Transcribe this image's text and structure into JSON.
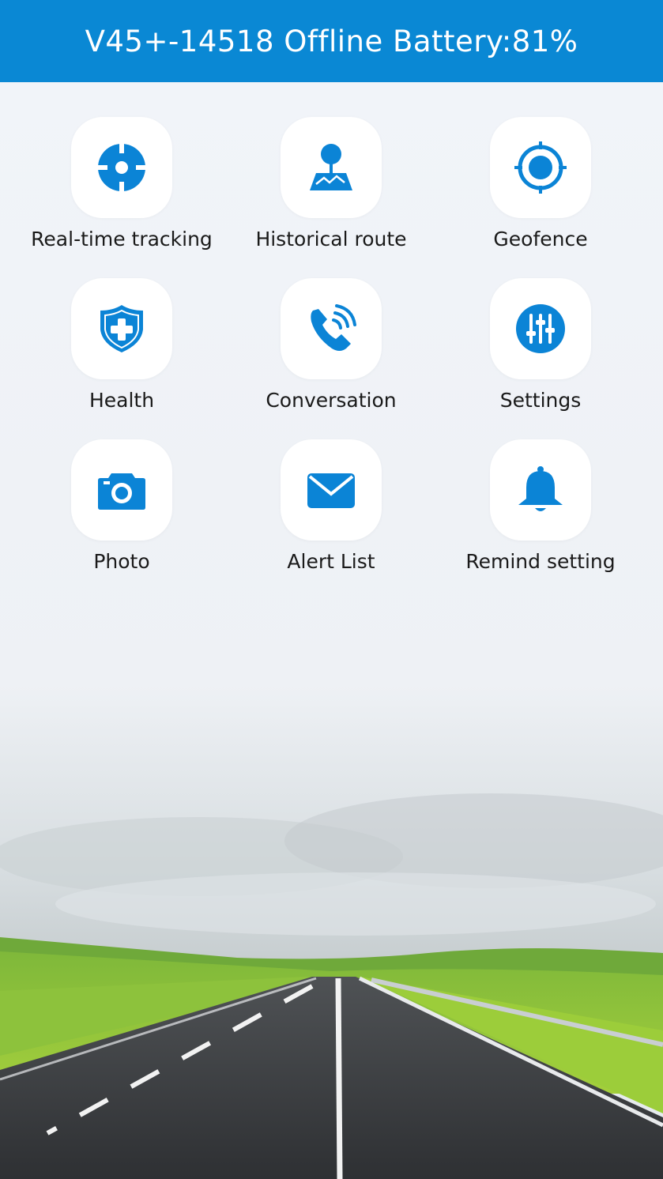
{
  "header": {
    "title": "V45+-14518 Offline Battery:81%"
  },
  "theme": {
    "accent": "#0a88d4",
    "icon_color": "#0b84d6",
    "tile_bg": "#ffffff",
    "page_bg": "#f1f4f9"
  },
  "menu": {
    "items": [
      {
        "label": "Real-time tracking",
        "icon": "crosshair-icon"
      },
      {
        "label": "Historical route",
        "icon": "map-pin-icon"
      },
      {
        "label": "Geofence",
        "icon": "target-icon"
      },
      {
        "label": "Health",
        "icon": "shield-plus-icon"
      },
      {
        "label": "Conversation",
        "icon": "phone-call-icon"
      },
      {
        "label": "Settings",
        "icon": "sliders-icon"
      },
      {
        "label": "Photo",
        "icon": "camera-icon"
      },
      {
        "label": "Alert List",
        "icon": "envelope-icon"
      },
      {
        "label": "Remind setting",
        "icon": "bell-icon"
      }
    ]
  },
  "background": {
    "scene": "road-landscape"
  }
}
